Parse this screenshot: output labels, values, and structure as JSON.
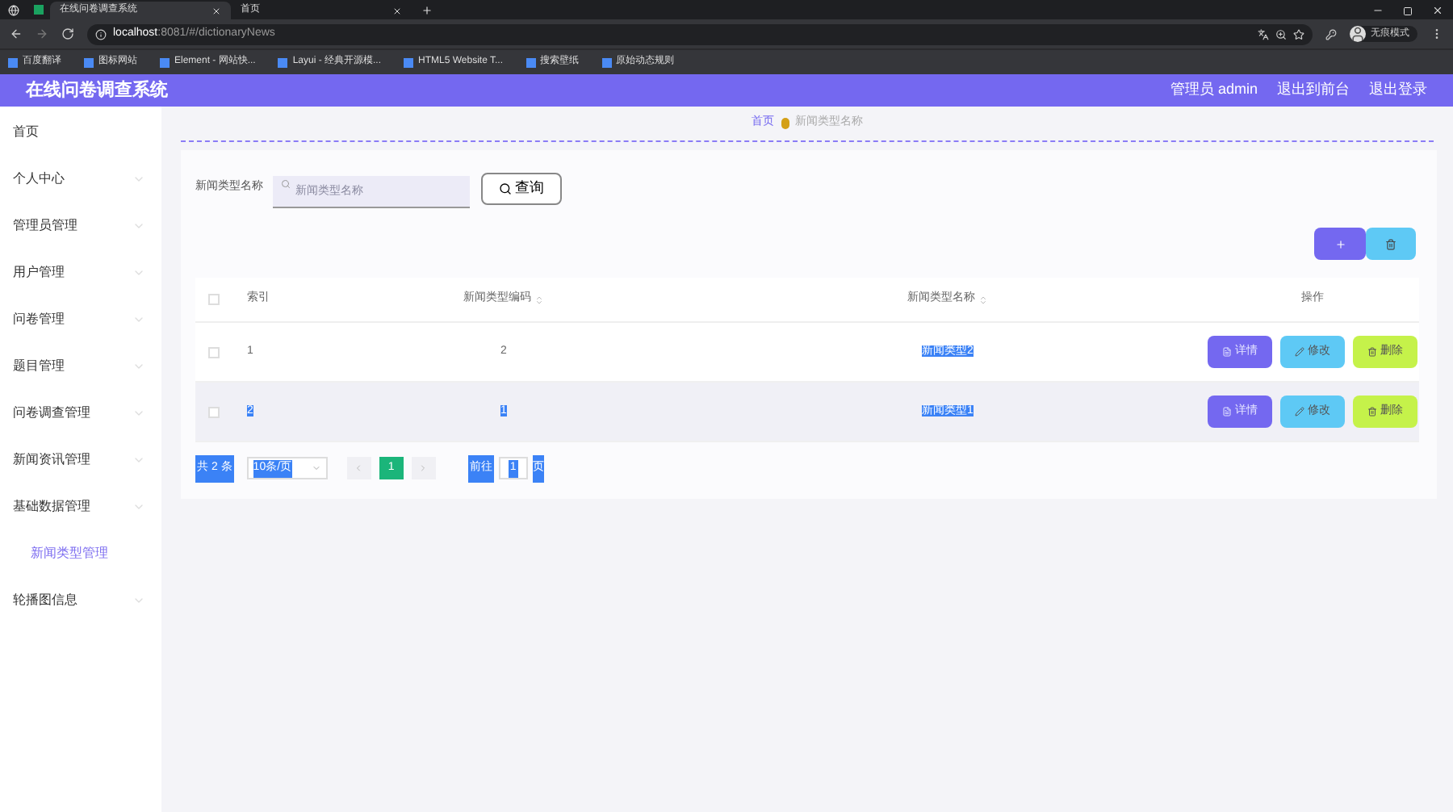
{
  "browser": {
    "tabs": [
      {
        "label": "在线问卷调查系统",
        "selected": true
      },
      {
        "label": "首页",
        "selected": false
      }
    ],
    "url_host": "localhost",
    "url_rest": ":8081/#/dictionaryNews",
    "profile": "无痕模式",
    "bookmarks": [
      "百度翻译",
      "图标网站",
      "Element - 网站快...",
      "Layui - 经典开源模...",
      "HTML5 Website T...",
      "搜索壁纸",
      "原始动态规则"
    ]
  },
  "header": {
    "title": "在线问卷调查系统",
    "links": [
      "管理员 admin",
      "退出到前台",
      "退出登录"
    ]
  },
  "sidebar": {
    "items": [
      {
        "label": "首页",
        "expandable": false,
        "selected": false
      },
      {
        "label": "个人中心",
        "expandable": true,
        "selected": false
      },
      {
        "label": "管理员管理",
        "expandable": true,
        "selected": false
      },
      {
        "label": "用户管理",
        "expandable": true,
        "selected": false
      },
      {
        "label": "问卷管理",
        "expandable": true,
        "selected": false
      },
      {
        "label": "题目管理",
        "expandable": true,
        "selected": false
      },
      {
        "label": "问卷调查管理",
        "expandable": true,
        "selected": false
      },
      {
        "label": "新闻资讯管理",
        "expandable": true,
        "selected": false
      },
      {
        "label": "基础数据管理",
        "expandable": true,
        "selected": false,
        "children": [
          {
            "label": "新闻类型管理",
            "expandable": false,
            "selected": true
          }
        ]
      },
      {
        "label": "轮播图信息",
        "expandable": true,
        "selected": false
      }
    ]
  },
  "breadcrumb": [
    "首页",
    "新闻类型名称"
  ],
  "search": {
    "label": "新闻类型名称",
    "placeholder": "新闻类型名称",
    "button": "查询"
  },
  "table": {
    "all_checked": false,
    "columns": [
      {
        "label": "索引",
        "sortable": false
      },
      {
        "label": "新闻类型编码",
        "sortable": true
      },
      {
        "label": "新闻类型名称",
        "sortable": true
      },
      {
        "label": "操作",
        "sortable": false
      }
    ],
    "rows": [
      {
        "cells": [
          {
            "text": "1",
            "highlighted": false
          },
          {
            "text": "2",
            "highlighted": false
          },
          {
            "text": "新闻类型2",
            "highlighted": true
          }
        ],
        "checked": false,
        "hovered": false,
        "actions": [
          "详情",
          "修改",
          "删除"
        ]
      },
      {
        "cells": [
          {
            "text": "2",
            "highlighted": true
          },
          {
            "text": "1",
            "highlighted": true
          },
          {
            "text": "新闻类型1",
            "highlighted": true
          }
        ],
        "checked": false,
        "hovered": true,
        "actions": [
          "详情",
          "修改",
          "删除"
        ]
      }
    ]
  },
  "pagination": {
    "total": {
      "text": "共 2 条",
      "highlighted": true
    },
    "page_size": {
      "text": "10条/页",
      "highlighted": true
    },
    "pages": [
      {
        "label": "1",
        "selected": true
      }
    ],
    "goto_label": {
      "text": "前往",
      "highlighted": true
    },
    "goto_value": {
      "text": "1",
      "highlighted": true
    },
    "goto_suffix": {
      "text": "页",
      "highlighted": true
    }
  }
}
